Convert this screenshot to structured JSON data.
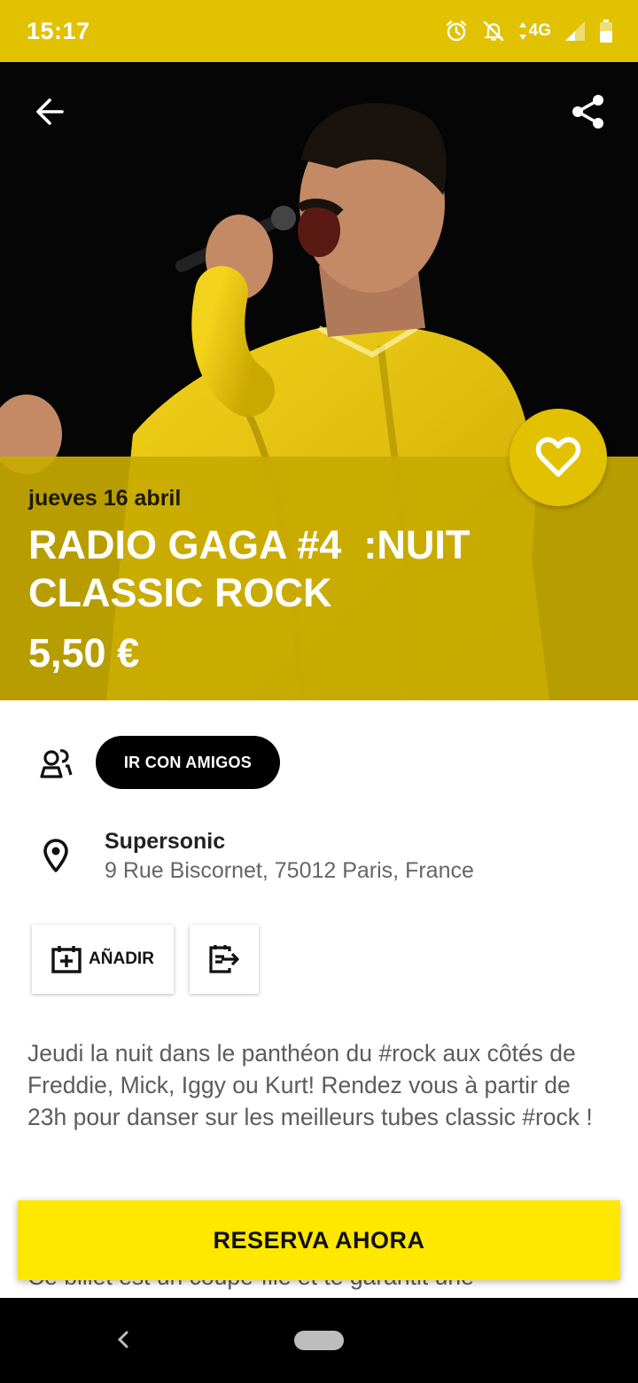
{
  "status_bar": {
    "time": "15:17",
    "network": "4G",
    "icons": [
      "alarm-icon",
      "notifications-off-icon",
      "signal-icon",
      "battery-icon"
    ]
  },
  "header": {
    "back_icon": "arrow-left-icon",
    "share_icon": "share-icon",
    "favorite_icon": "heart-outline-icon"
  },
  "event": {
    "date": "jueves 16 abril",
    "title": "RADIO GAGA #4  :NUIT\nCLASSIC ROCK",
    "price": "5,50 €"
  },
  "friends": {
    "icon": "group-icon",
    "button_label": "IR CON AMIGOS"
  },
  "venue": {
    "icon": "location-pin-icon",
    "name": "Supersonic",
    "address": "9 Rue Biscornet, 75012 Paris, France"
  },
  "actions": {
    "add_label": "AÑADIR",
    "add_icon": "calendar-add-icon",
    "export_icon": "calendar-export-icon"
  },
  "description": "Jeudi la nuit dans le panthéon du #rock aux côtés de Freddie, Mick, Iggy ou Kurt! Rendez vous à partir de 23h pour danser sur les meilleurs tubes classic #rock  !",
  "description_more": "Ce billet est un coupe-file et te garantit une",
  "reserve": {
    "label": "RESERVA AHORA"
  },
  "colors": {
    "brand_yellow": "#e1c100",
    "panel_yellow": "#c8aa00",
    "reserve_yellow": "#ffe800"
  }
}
